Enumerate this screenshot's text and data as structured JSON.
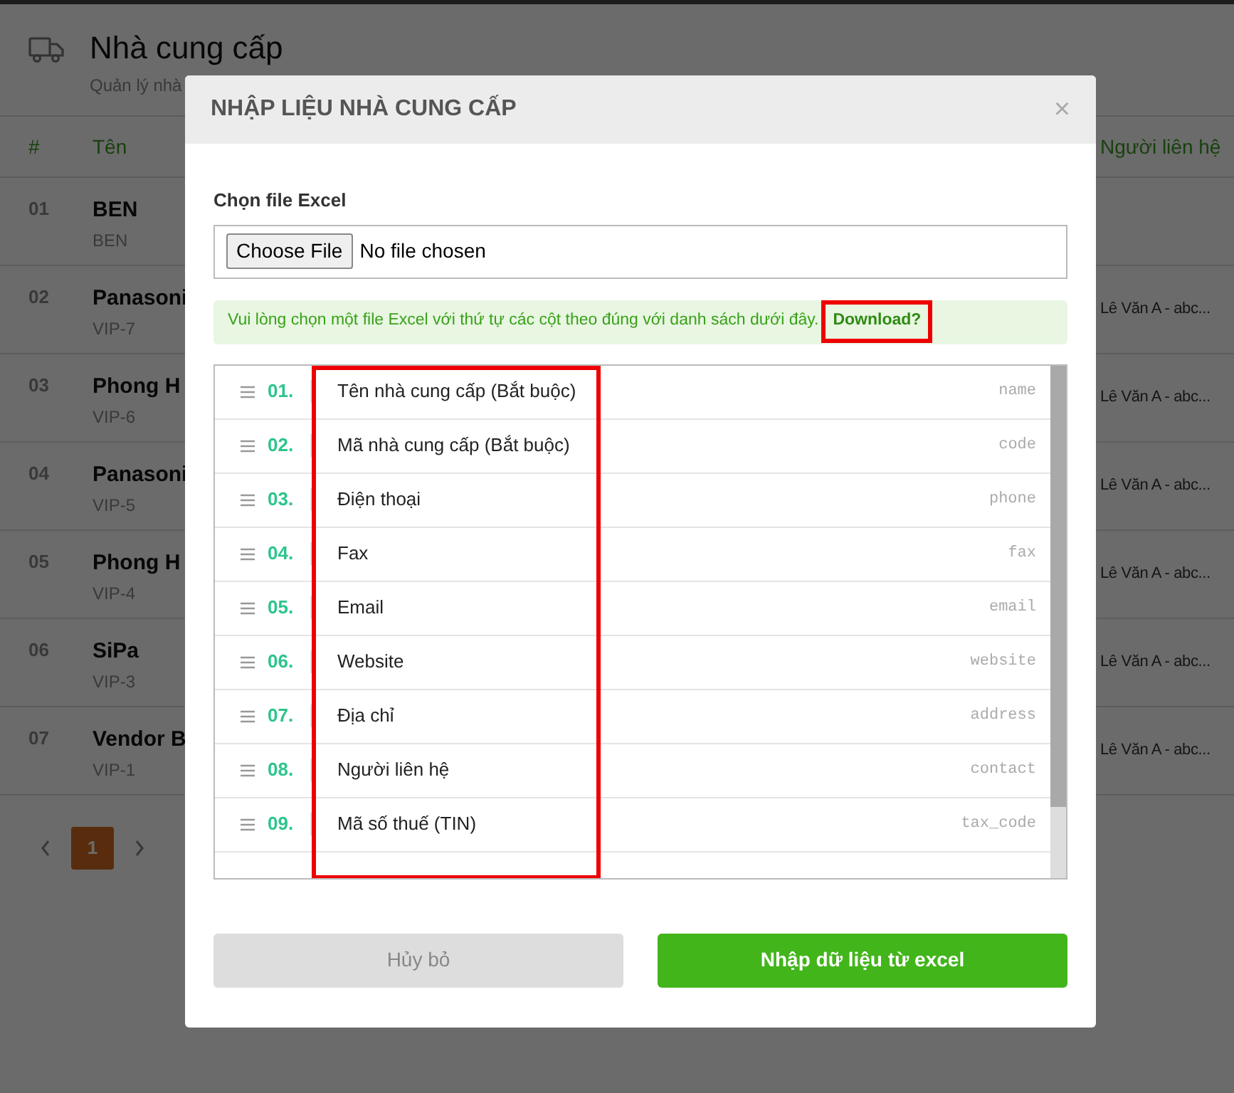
{
  "page": {
    "title": "Nhà cung cấp",
    "subtitle": "Quản lý nhà"
  },
  "table": {
    "columns": [
      "#",
      "Tên",
      "Người liên hệ"
    ],
    "rows": [
      {
        "index": "01",
        "name": "BEN",
        "code": "BEN"
      },
      {
        "index": "02",
        "name": "Panasoni",
        "code": "VIP-7",
        "contact": "Lê Văn A - abc..."
      },
      {
        "index": "03",
        "name": "Phong H",
        "code": "VIP-6",
        "contact": "Lê Văn A - abc..."
      },
      {
        "index": "04",
        "name": "Panasoni",
        "code": "VIP-5",
        "contact": "Lê Văn A - abc..."
      },
      {
        "index": "05",
        "name": "Phong H",
        "code": "VIP-4",
        "contact": "Lê Văn A - abc..."
      },
      {
        "index": "06",
        "name": "SiPa",
        "code": "VIP-3",
        "contact": "Lê Văn A - abc..."
      },
      {
        "index": "07",
        "name": "Vendor B",
        "code": "VIP-1",
        "contact": "Lê Văn A - abc..."
      }
    ]
  },
  "pagination": {
    "pages": [
      {
        "label": "1",
        "selected": true
      }
    ]
  },
  "modal": {
    "title": "NHẬP LIỆU NHÀ CUNG CẤP",
    "close": "×",
    "file_label": "Chọn file Excel",
    "file_button": "Choose File",
    "file_status": "No file chosen",
    "notice": "Vui lòng chọn một file Excel với thứ tự các cột theo đúng với danh sách dưới đây.",
    "download_link": "Download?",
    "download_highlighted": true,
    "fields_highlighted": true,
    "fields": [
      {
        "number": "01.",
        "label": "Tên nhà cung cấp (Bắt buộc)",
        "key": "name"
      },
      {
        "number": "02.",
        "label": "Mã nhà cung cấp (Bắt buộc)",
        "key": "code"
      },
      {
        "number": "03.",
        "label": "Điện thoại",
        "key": "phone"
      },
      {
        "number": "04.",
        "label": "Fax",
        "key": "fax"
      },
      {
        "number": "05.",
        "label": "Email",
        "key": "email"
      },
      {
        "number": "06.",
        "label": "Website",
        "key": "website"
      },
      {
        "number": "07.",
        "label": "Địa chỉ",
        "key": "address"
      },
      {
        "number": "08.",
        "label": "Người liên hệ",
        "key": "contact"
      },
      {
        "number": "09.",
        "label": "Mã số thuế (TIN)",
        "key": "tax_code"
      }
    ],
    "buttons": [
      {
        "label": "Hủy bỏ",
        "kind": "cancel"
      },
      {
        "label": "Nhập dữ liệu từ excel",
        "kind": "primary"
      }
    ]
  }
}
